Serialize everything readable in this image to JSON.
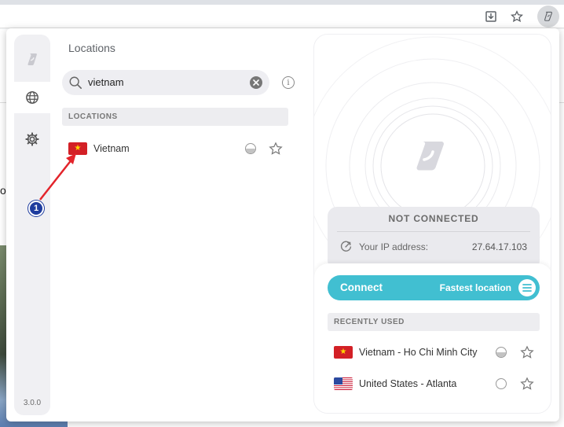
{
  "browser": {
    "toolbar_icons": [
      "download-icon",
      "star-icon",
      "surfshark-extension-icon"
    ]
  },
  "sidebar": {
    "items": [
      {
        "name": "surfshark-logo-icon",
        "active": false
      },
      {
        "name": "globe-icon",
        "active": true
      },
      {
        "name": "gear-icon",
        "active": false
      }
    ],
    "version": "3.0.0"
  },
  "locations": {
    "title": "Locations",
    "search": {
      "value": "vietnam",
      "placeholder": ""
    },
    "section_header": "LOCATIONS",
    "results": [
      {
        "flag": "vietnam",
        "label": "Vietnam",
        "load": 0.5,
        "favorite": false
      }
    ]
  },
  "annotation": {
    "marker": "1"
  },
  "connection": {
    "status": "NOT CONNECTED",
    "ip_label": "Your IP address:",
    "ip_value": "27.64.17.103",
    "connect_label": "Connect",
    "fastest_label": "Fastest location",
    "recent_header": "RECENTLY USED",
    "recent": [
      {
        "flag": "vietnam",
        "label": "Vietnam - Ho Chi Minh City",
        "load": 0.5,
        "favorite": false
      },
      {
        "flag": "united-states",
        "label": "United States - Atlanta",
        "load": 0.0,
        "favorite": false
      }
    ]
  },
  "colors": {
    "accent": "#41bfd1",
    "marker": "#1e3c9e",
    "arrow": "#e3242b",
    "vn_flag_red": "#d32026",
    "vn_flag_star": "#ffd800"
  }
}
